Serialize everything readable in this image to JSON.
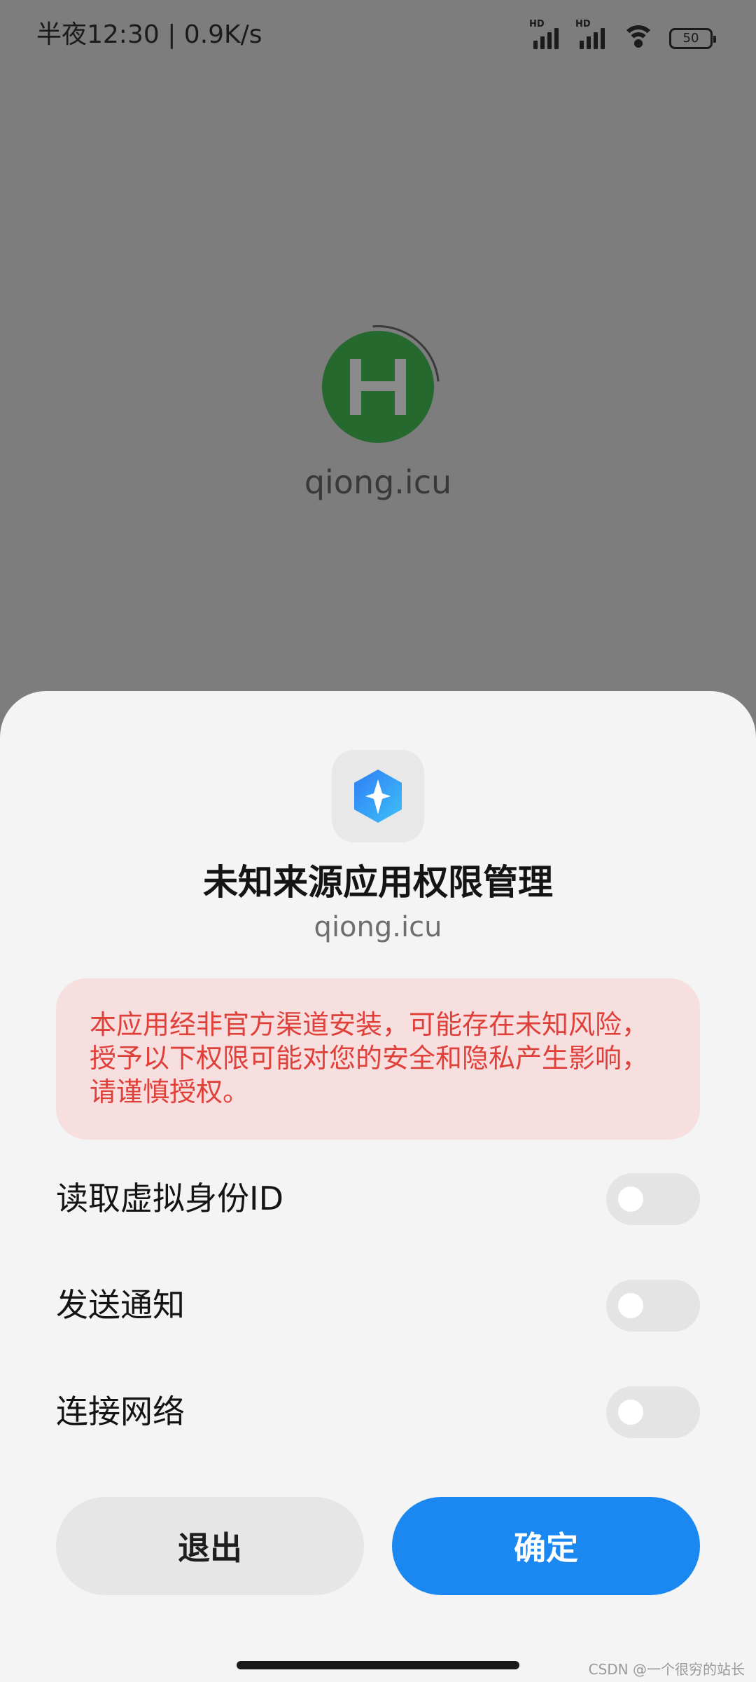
{
  "status_bar": {
    "time": "半夜12:30",
    "separator": "|",
    "net_speed": "0.9K/s",
    "signal_1_label": "HD",
    "signal_2_label": "HD",
    "battery": "50",
    "icons": [
      "signal-icon",
      "signal-icon",
      "wifi-icon",
      "battery-icon"
    ]
  },
  "background_app": {
    "icon": "h-app-icon",
    "icon_color": "#26692f",
    "name": "qiong.icu"
  },
  "dialog": {
    "icon": "security-shield-icon",
    "title": "未知来源应用权限管理",
    "source": "qiong.icu",
    "warning": "本应用经非官方渠道安装，可能存在未知风险，授予以下权限可能对您的安全和隐私产生影响，请谨慎授权。",
    "warning_color": "#e0403a",
    "permissions": [
      {
        "label": "读取虚拟身份ID",
        "enabled": false
      },
      {
        "label": "发送通知",
        "enabled": false
      },
      {
        "label": "连接网络",
        "enabled": false
      }
    ],
    "cancel_label": "退出",
    "confirm_label": "确定",
    "confirm_color": "#1b87f0"
  },
  "watermark": "CSDN @一个很穷的站长"
}
